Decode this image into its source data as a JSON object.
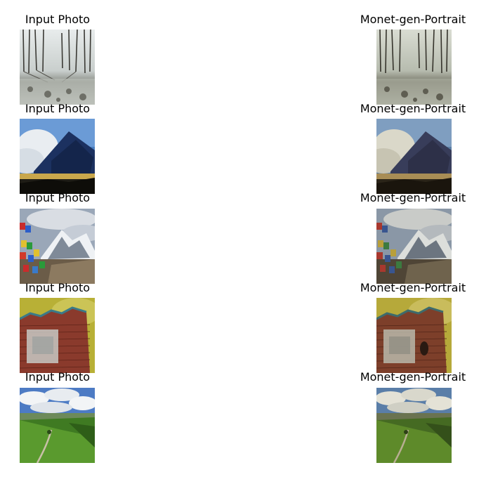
{
  "rows": [
    {
      "left_title": "Input Photo",
      "right_title": "Monet-gen-Portrait",
      "scene": "frosty-forest"
    },
    {
      "left_title": "Input Photo",
      "right_title": "Monet-gen-Portrait",
      "scene": "storm-cloud"
    },
    {
      "left_title": "Input Photo",
      "right_title": "Monet-gen-Portrait",
      "scene": "mountain-prayer-flags"
    },
    {
      "left_title": "Input Photo",
      "right_title": "Monet-gen-Portrait",
      "scene": "brick-wall"
    },
    {
      "left_title": "Input Photo",
      "right_title": "Monet-gen-Portrait",
      "scene": "green-hills"
    }
  ]
}
